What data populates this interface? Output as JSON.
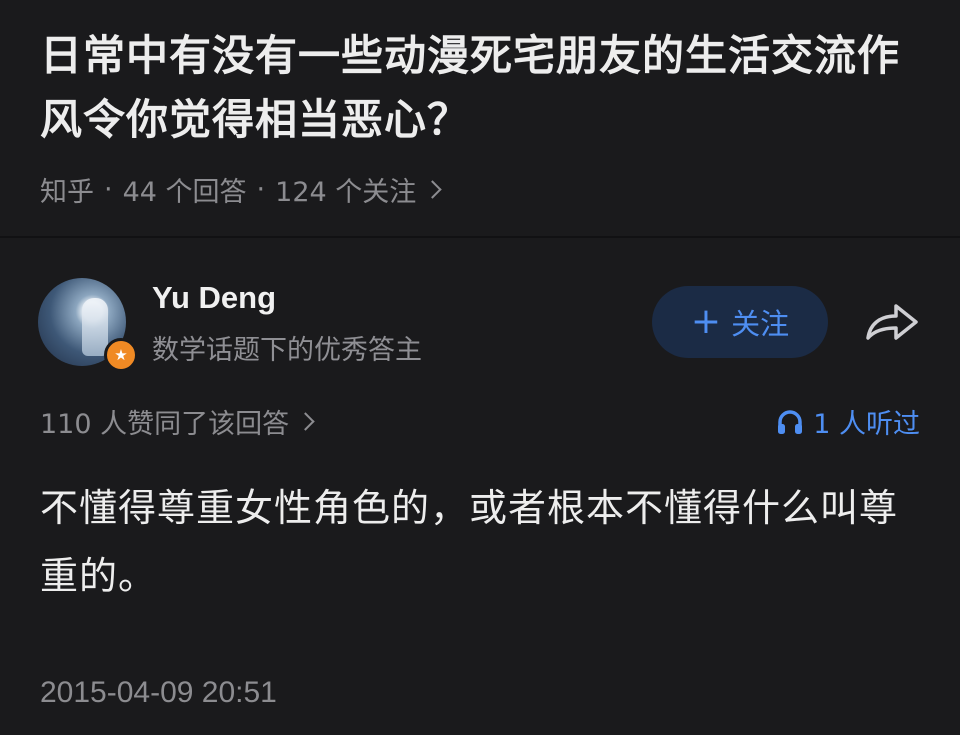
{
  "question": {
    "title": "日常中有没有一些动漫死宅朋友的生活交流作风令你觉得相当恶心？",
    "source": "知乎",
    "sep": "·",
    "answers_count": "44 个回答",
    "followers_count": "124 个关注"
  },
  "author": {
    "name": "Yu Deng",
    "description": "数学话题下的优秀答主",
    "badge_icon": "star-badge-icon",
    "follow_label": "关注",
    "follow_plus": "+"
  },
  "answer": {
    "votes_text": "110 人赞同了该回答",
    "listen_text": "1 人听过",
    "content": "不懂得尊重女性角色的，或者根本不懂得什么叫尊重的。",
    "timestamp": "2015-04-09 20:51"
  },
  "colors": {
    "background": "#1a1a1c",
    "text": "#ededed",
    "muted": "#8c8c90",
    "accent": "#4e8ef2",
    "follow_bg": "#1b2b45",
    "badge": "#f08a24"
  },
  "icons": {
    "share": "share-arrow-icon",
    "listen": "headphones-icon",
    "chevron": "chevron-right-icon"
  }
}
